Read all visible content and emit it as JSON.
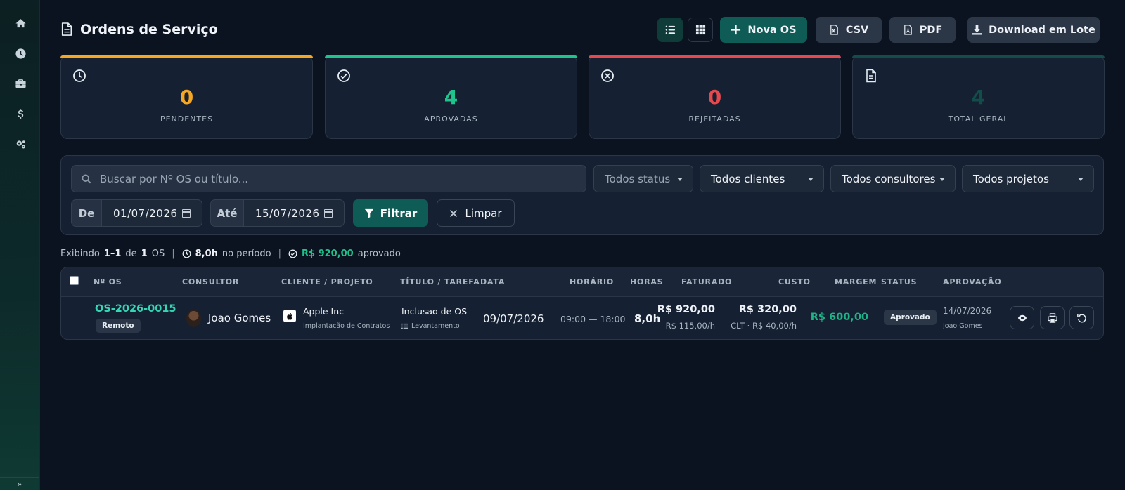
{
  "header": {
    "title": "Ordens de Serviço",
    "buttons": {
      "new_os": "Nova OS",
      "csv": "CSV",
      "pdf": "PDF",
      "download_batch": "Download em Lote"
    }
  },
  "stats": [
    {
      "value": "0",
      "label": "PENDENTES",
      "color": "#f5a623",
      "icon": "clock-icon"
    },
    {
      "value": "4",
      "label": "APROVADAS",
      "color": "#1fc48c",
      "icon": "check-circle-icon"
    },
    {
      "value": "0",
      "label": "REJEITADAS",
      "color": "#e5484d",
      "icon": "x-circle-icon"
    },
    {
      "value": "4",
      "label": "TOTAL GERAL",
      "color": "#134d4a",
      "icon": "document-icon"
    }
  ],
  "filters": {
    "search_placeholder": "Buscar por Nº OS ou título...",
    "status": "Todos status",
    "clients": "Todos clientes",
    "consultants": "Todos consultores",
    "projects": "Todos projetos",
    "from_label": "De",
    "from_date": "01/07/2026",
    "to_label": "Até",
    "to_date": "15/07/2026",
    "filter_button": "Filtrar",
    "clear_button": "Limpar"
  },
  "summary": {
    "prefix": "Exibindo",
    "range": "1–1",
    "of": "de",
    "total": "1",
    "unit": "OS",
    "hours": "8,0h",
    "hours_suffix": "no período",
    "approved_value": "R$ 920,00",
    "approved_suffix": "aprovado"
  },
  "table": {
    "columns": {
      "os": "Nº OS",
      "consultant": "CONSULTOR",
      "client": "CLIENTE / PROJETO",
      "task": "TÍTULO / TAREFA",
      "date": "DATA",
      "time": "HORÁRIO",
      "hours": "HORAS",
      "billed": "FATURADO",
      "cost": "CUSTO",
      "margin": "MARGEM",
      "status": "STATUS",
      "approval": "APROVAÇÃO"
    },
    "rows": [
      {
        "os": "OS-2026-0015",
        "mode": "Remoto",
        "consultant": "Joao Gomes",
        "client": "Apple Inc",
        "project": "Implantação de Contratos",
        "title": "Inclusao de OS",
        "task": "Levantamento",
        "date": "09/07/2026",
        "time": "09:00 — 18:00",
        "hours": "8,0h",
        "billed": "R$ 920,00",
        "billed_rate": "R$ 115,00/h",
        "cost": "R$ 320,00",
        "cost_detail": "CLT · R$ 40,00/h",
        "margin": "R$ 600,00",
        "status": "Aprovado",
        "approval_date": "14/07/2026",
        "approved_by": "Joao Gomes"
      }
    ]
  },
  "colors": {
    "accent": "#0f5b55",
    "teal_text": "#35d6b5",
    "green": "#1fb386"
  }
}
